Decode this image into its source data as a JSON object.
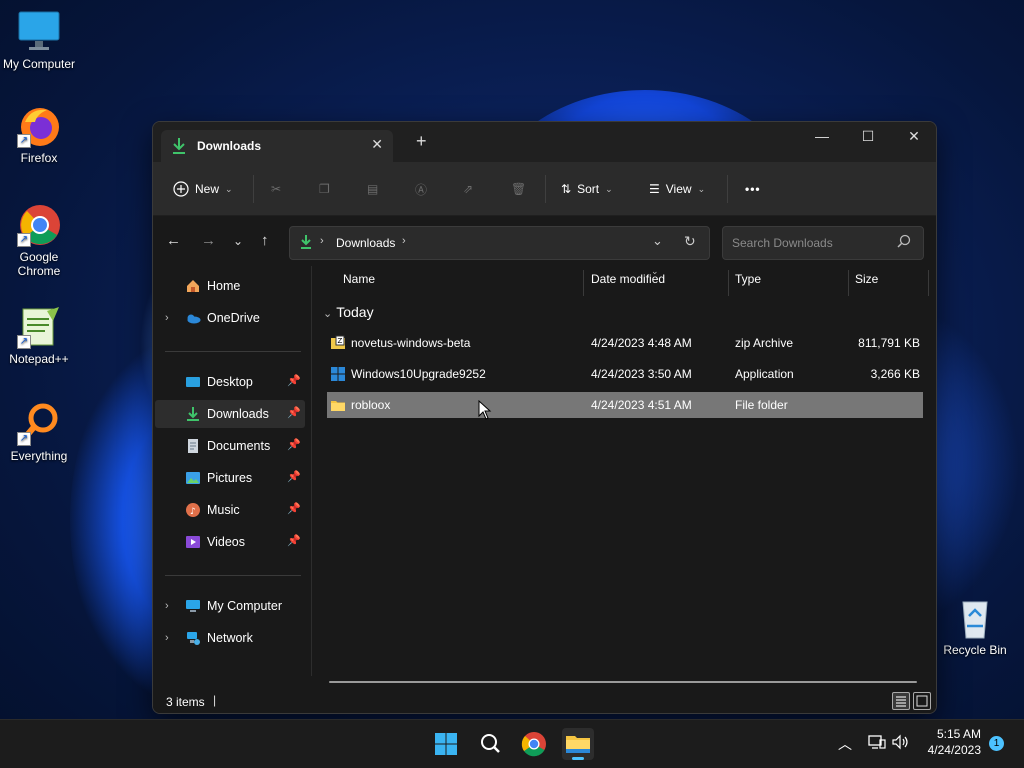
{
  "desktop": {
    "icons": [
      {
        "label": "My Computer"
      },
      {
        "label": "Firefox"
      },
      {
        "label": "Google Chrome"
      },
      {
        "label": "Notepad++"
      },
      {
        "label": "Everything"
      },
      {
        "label": "Recycle Bin"
      }
    ]
  },
  "window": {
    "tab_title": "Downloads",
    "tab_close": "✕",
    "new_tab": "+",
    "minimize": "—",
    "maximize": "☐",
    "close": "✕"
  },
  "commandbar": {
    "new_label": "New",
    "sort_label": "Sort",
    "view_label": "View",
    "more_label": "•••"
  },
  "nav": {
    "breadcrumb": "Downloads",
    "search_placeholder": "Search Downloads"
  },
  "sidebar": {
    "items": [
      {
        "label": "Home"
      },
      {
        "label": "OneDrive"
      },
      {
        "label": "Desktop"
      },
      {
        "label": "Downloads"
      },
      {
        "label": "Documents"
      },
      {
        "label": "Pictures"
      },
      {
        "label": "Music"
      },
      {
        "label": "Videos"
      },
      {
        "label": "My Computer"
      },
      {
        "label": "Network"
      }
    ]
  },
  "columns": {
    "name": "Name",
    "date": "Date modified",
    "type": "Type",
    "size": "Size"
  },
  "group_label": "Today",
  "files": [
    {
      "name": "novetus-windows-beta",
      "date": "4/24/2023 4:48 AM",
      "type": "zip Archive",
      "size": "811,791 KB"
    },
    {
      "name": "Windows10Upgrade9252",
      "date": "4/24/2023 3:50 AM",
      "type": "Application",
      "size": "3,266 KB"
    },
    {
      "name": "robloox",
      "date": "4/24/2023 4:51 AM",
      "type": "File folder",
      "size": ""
    }
  ],
  "status": {
    "item_count": "3 items"
  },
  "taskbar": {
    "time": "5:15 AM",
    "date": "4/24/2023",
    "notification_count": "1"
  },
  "colors": {
    "accent": "#4cc2ff",
    "window_bg": "#191919",
    "selected_row": "#777777"
  }
}
